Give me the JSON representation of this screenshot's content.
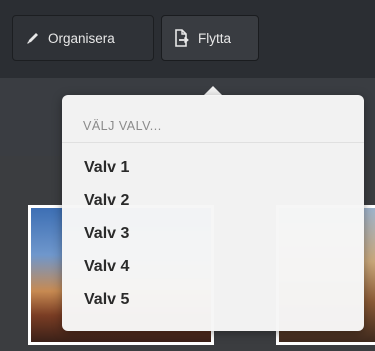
{
  "toolbar": {
    "organize_label": "Organisera",
    "organize_icon": "pencil-icon",
    "move_label": "Flytta",
    "move_icon": "move-file-icon"
  },
  "dropdown": {
    "header": "VÄLJ VALV...",
    "items": [
      {
        "label": "Valv 1"
      },
      {
        "label": "Valv 2"
      },
      {
        "label": "Valv 3"
      },
      {
        "label": "Valv 4"
      },
      {
        "label": "Valv 5"
      }
    ]
  },
  "colors": {
    "toolbar_bg": "#2b2e33",
    "dropdown_bg": "#f6f6f6",
    "menu_text": "#2a2a2a",
    "header_text": "#8a8a8a"
  }
}
